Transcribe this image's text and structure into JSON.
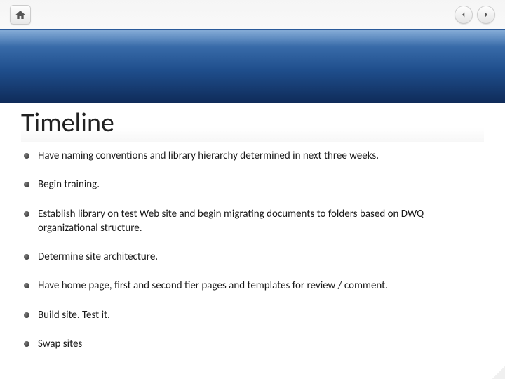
{
  "slide": {
    "title": "Timeline",
    "bullets": [
      "Have naming conventions and library hierarchy determined in next three weeks.",
      "Begin training.",
      "Establish library on test Web site and begin migrating documents to folders based on DWQ organizational structure.",
      "Determine site architecture.",
      "Have home page, first and second tier pages and templates for review / comment.",
      "Build site. Test it.",
      "Swap sites"
    ]
  }
}
